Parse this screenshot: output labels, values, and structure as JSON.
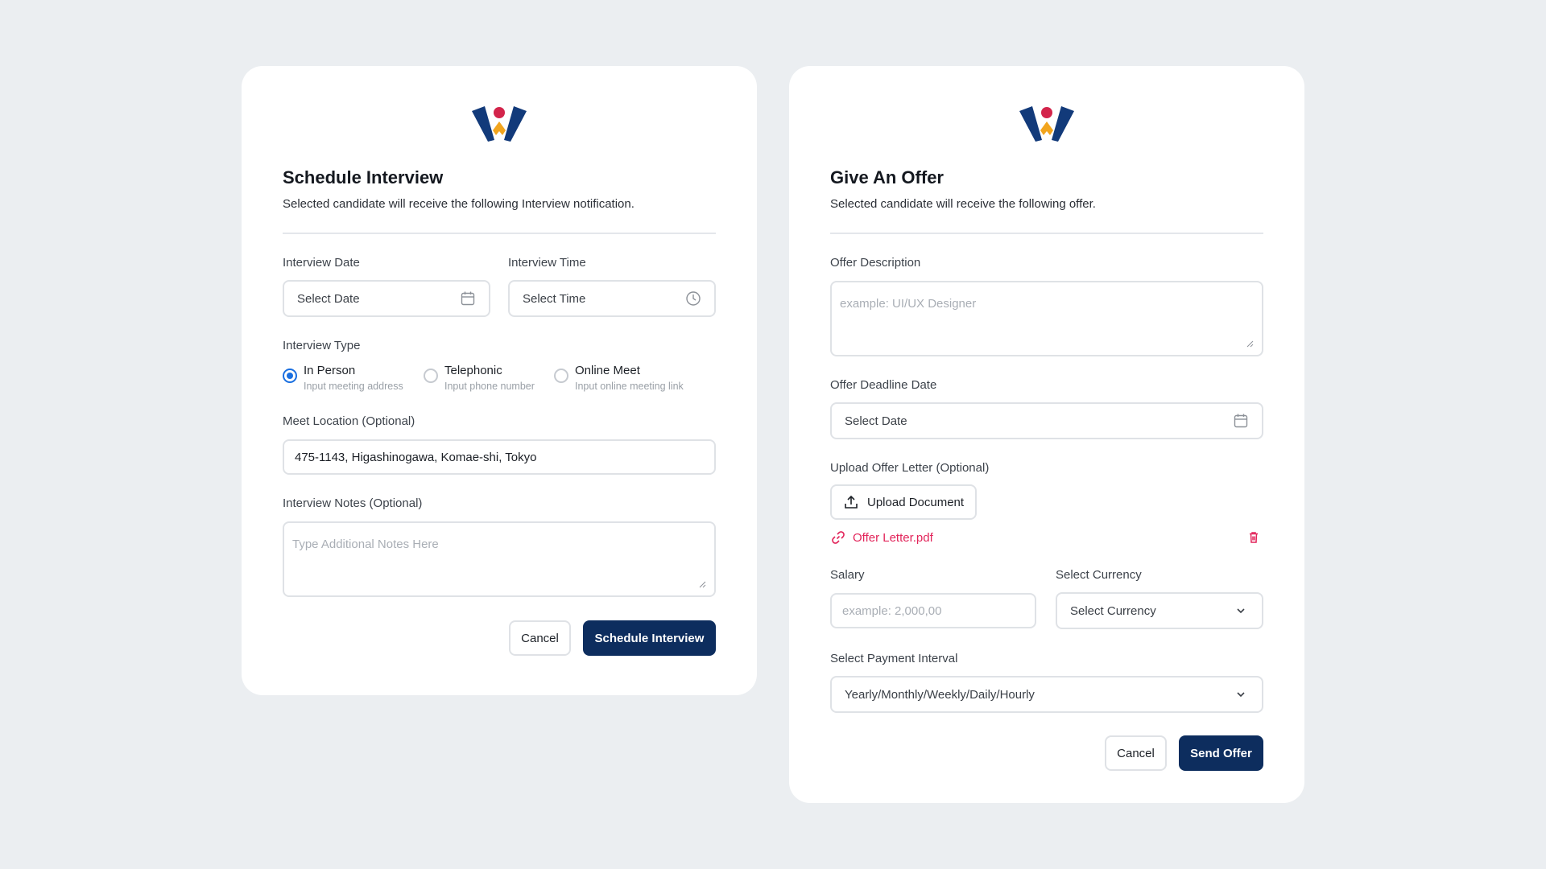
{
  "schedule": {
    "title": "Schedule Interview",
    "subtitle": "Selected candidate will receive the following Interview notification.",
    "date_label": "Interview Date",
    "date_value": "Select Date",
    "time_label": "Interview Time",
    "time_value": "Select Time",
    "type_label": "Interview Type",
    "types": [
      {
        "title": "In Person",
        "sub": "Input meeting address",
        "checked": true
      },
      {
        "title": "Telephonic",
        "sub": "Input phone number",
        "checked": false
      },
      {
        "title": "Online Meet",
        "sub": "Input online meeting link",
        "checked": false
      }
    ],
    "location_label": "Meet Location (Optional)",
    "location_value": "475-1143, Higashinogawa, Komae-shi, Tokyo",
    "notes_label": "Interview Notes (Optional)",
    "notes_placeholder": "Type Additional Notes Here",
    "cancel_label": "Cancel",
    "submit_label": "Schedule Interview"
  },
  "offer": {
    "title": "Give An Offer",
    "subtitle": "Selected candidate will receive the following offer.",
    "description_label": "Offer Description",
    "description_placeholder": "example: UI/UX Designer",
    "deadline_label": "Offer Deadline Date",
    "deadline_value": "Select Date",
    "upload_label": "Upload Offer Letter (Optional)",
    "upload_button": "Upload Document",
    "file_name": "Offer Letter.pdf",
    "salary_label": "Salary",
    "salary_placeholder": "example: 2,000,00",
    "currency_label": "Select Currency",
    "currency_value": "Select Currency",
    "interval_label": "Select Payment Interval",
    "interval_value": "Yearly/Monthly/Weekly/Daily/Hourly",
    "cancel_label": "Cancel",
    "submit_label": "Send Offer"
  },
  "icons": {
    "logo": "brand-logo",
    "calendar": "calendar-icon",
    "clock": "clock-icon",
    "upload": "upload-icon",
    "link": "link-icon",
    "trash": "trash-icon",
    "chevron": "chevron-down-icon"
  },
  "colors": {
    "primary": "#0d2d5e",
    "radio_active": "#1a6fe0",
    "file_accent": "#e2245a",
    "logo_red": "#d3244b",
    "logo_orange": "#f2a51e",
    "logo_navy": "#123a7a"
  }
}
